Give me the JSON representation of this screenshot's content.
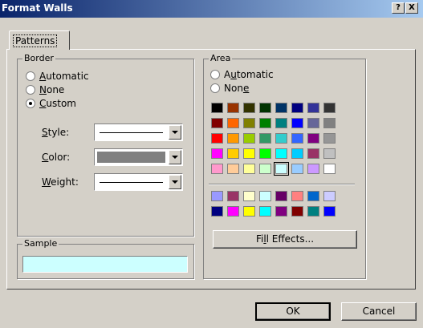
{
  "window": {
    "title": "Format Walls",
    "help_label": "?",
    "close_label": "X"
  },
  "tabs": [
    {
      "label": "Patterns"
    }
  ],
  "border": {
    "legend": "Border",
    "options": [
      {
        "pre": "",
        "key": "A",
        "post": "utomatic",
        "checked": false
      },
      {
        "pre": "",
        "key": "N",
        "post": "one",
        "checked": false
      },
      {
        "pre": "",
        "key": "C",
        "post": "ustom",
        "checked": true
      }
    ],
    "style": {
      "pre": "",
      "key": "S",
      "post": "tyle:"
    },
    "color": {
      "pre": "",
      "key": "C",
      "post": "olor:",
      "value": "#808080"
    },
    "weight": {
      "pre": "",
      "key": "W",
      "post": "eight:"
    }
  },
  "sample": {
    "legend": "Sample",
    "color": "#ccffff"
  },
  "area": {
    "legend": "Area",
    "options": [
      {
        "pre": "A",
        "key": "u",
        "post": "tomatic",
        "checked": false
      },
      {
        "pre": "Non",
        "key": "e",
        "post": "",
        "checked": false
      }
    ],
    "palette_top": [
      "#000000",
      "#993300",
      "#333300",
      "#003300",
      "#003366",
      "#000080",
      "#333399",
      "#333333",
      "#800000",
      "#ff6600",
      "#808000",
      "#008000",
      "#008080",
      "#0000ff",
      "#666699",
      "#808080",
      "#ff0000",
      "#ff9900",
      "#99cc00",
      "#339966",
      "#33cccc",
      "#3366ff",
      "#800080",
      "#969696",
      "#ff00ff",
      "#ffcc00",
      "#ffff00",
      "#00ff00",
      "#00ffff",
      "#00ccff",
      "#993366",
      "#c0c0c0",
      "#ff99cc",
      "#ffcc99",
      "#ffff99",
      "#ccffcc",
      "#ccffff",
      "#99ccff",
      "#cc99ff",
      "#ffffff"
    ],
    "selected_index": 36,
    "palette_bottom": [
      "#9999ff",
      "#993366",
      "#ffffcc",
      "#ccffff",
      "#660066",
      "#ff8080",
      "#0066cc",
      "#ccccff",
      "#000080",
      "#ff00ff",
      "#ffff00",
      "#00ffff",
      "#800080",
      "#800000",
      "#008080",
      "#0000ff"
    ],
    "fill_effects": {
      "pre": "Fi",
      "key": "l",
      "post": "l Effects..."
    }
  },
  "buttons": {
    "ok": "OK",
    "cancel": "Cancel"
  }
}
